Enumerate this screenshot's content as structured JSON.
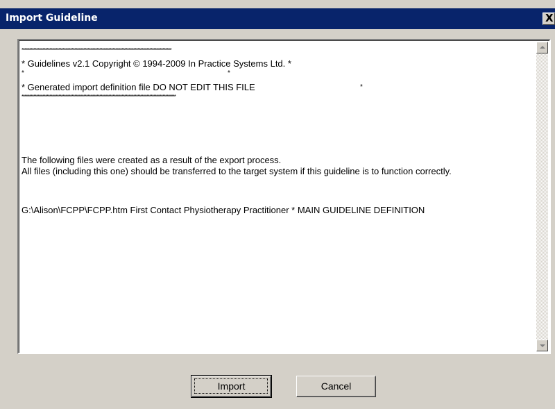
{
  "window": {
    "title": "Import Guideline",
    "close_label": "X"
  },
  "content": {
    "star_line_1": "******************************************************************************************************",
    "header_line": "*    Guidelines v2.1    Copyright © 1994-2009 In Practice Systems Ltd. *",
    "star_single_left": "*",
    "star_single_mid": "*",
    "generated_line": "* Generated import definition file   DO NOT EDIT THIS FILE",
    "generated_star": "*",
    "star_line_2": "*********************************************************************************************************",
    "paragraph_1": "The following files were created as a result of the export process.",
    "paragraph_2": "All files (including this one) should be transferred to the target system if this guideline is to function correctly.",
    "file_entry": "   G:\\Alison\\FCPP\\FCPP.htm  First Contact Physiotherapy Practitioner * MAIN GUIDELINE DEFINITION"
  },
  "buttons": {
    "import_label": "Import",
    "cancel_label": "Cancel"
  },
  "icons": {
    "close": "close-icon",
    "scroll_up": "scroll-up-arrow-icon",
    "scroll_down": "scroll-down-arrow-icon"
  }
}
